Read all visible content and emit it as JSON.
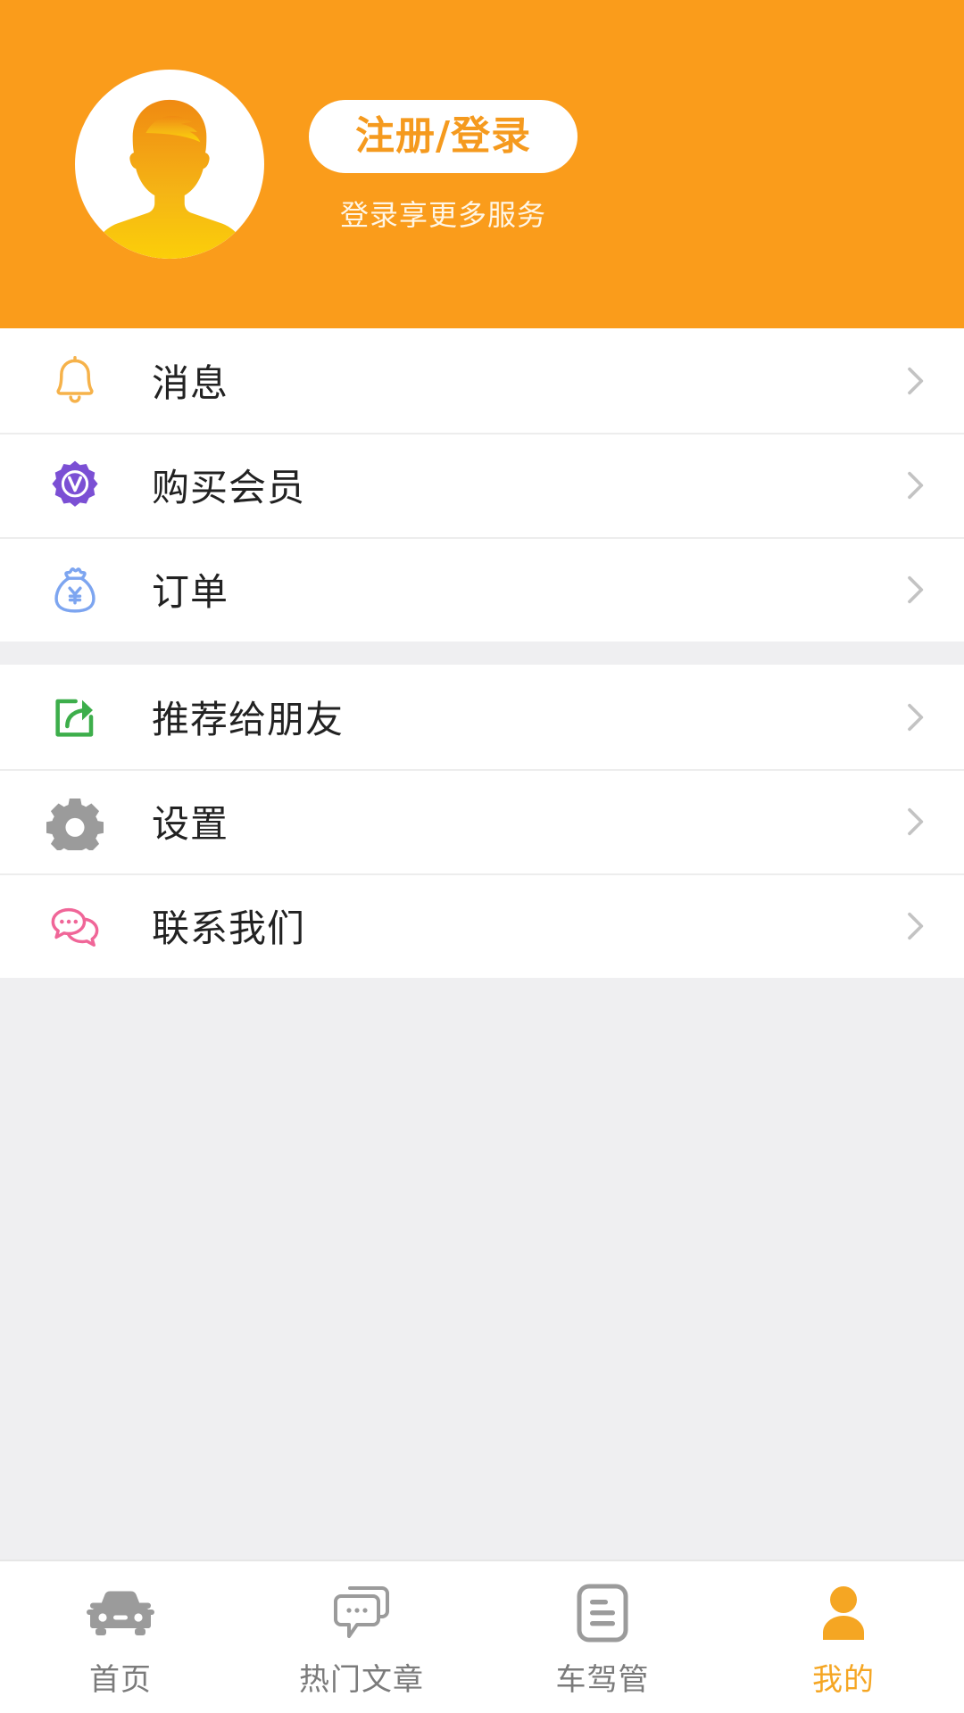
{
  "header": {
    "avatar_icon": "user-avatar-placeholder",
    "login_button_label": "注册/登录",
    "login_subtitle": "登录享更多服务",
    "background_color": "#FA9C1B",
    "button_text_color": "#F59A1E"
  },
  "menu_groups": [
    {
      "items": [
        {
          "label": "消息",
          "icon": "bell-icon",
          "icon_color": "#F6B24A",
          "chevron": "chevron-right-icon"
        },
        {
          "label": "购买会员",
          "icon": "vip-badge-icon",
          "icon_color": "#7B4FD4",
          "chevron": "chevron-right-icon"
        },
        {
          "label": "订单",
          "icon": "money-bag-icon",
          "icon_color": "#7DA5F0",
          "chevron": "chevron-right-icon"
        }
      ]
    },
    {
      "items": [
        {
          "label": "推荐给朋友",
          "icon": "share-icon",
          "icon_color": "#3DAE4B",
          "chevron": "chevron-right-icon"
        },
        {
          "label": "设置",
          "icon": "gear-icon",
          "icon_color": "#9B9B9B",
          "chevron": "chevron-right-icon"
        },
        {
          "label": "联系我们",
          "icon": "chat-bubbles-icon",
          "icon_color": "#F06698",
          "chevron": "chevron-right-icon"
        }
      ]
    }
  ],
  "tabbar": {
    "active_color": "#F5A623",
    "inactive_color": "#7B7B7B",
    "tabs": [
      {
        "label": "首页",
        "icon": "car-icon",
        "active": false
      },
      {
        "label": "热门文章",
        "icon": "chat-bubbles-icon",
        "active": false
      },
      {
        "label": "车驾管",
        "icon": "document-icon",
        "active": false
      },
      {
        "label": "我的",
        "icon": "person-icon",
        "active": true
      }
    ]
  }
}
